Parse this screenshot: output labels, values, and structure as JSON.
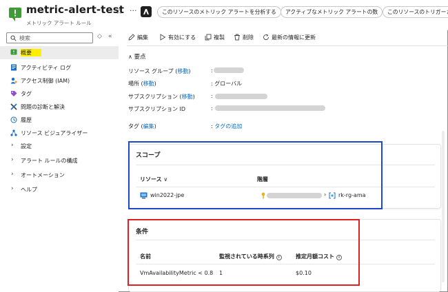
{
  "header": {
    "title": "metric-alert-test",
    "subtitle": "メトリック アラート ルール",
    "star": "☆",
    "more": "···",
    "pills": [
      "このリソースのメトリック アラートを分析する",
      "アクティブなメトリック アラートの数",
      "このリソースのトリガーさ"
    ]
  },
  "sidebar": {
    "search_placeholder": "検索",
    "items": [
      {
        "label": "概要",
        "icon": "overview-icon",
        "selected": true
      },
      {
        "label": "アクティビティ ログ",
        "icon": "activity-log-icon"
      },
      {
        "label": "アクセス制御 (IAM)",
        "icon": "iam-icon"
      },
      {
        "label": "タグ",
        "icon": "tag-icon"
      },
      {
        "label": "問題の診断と解決",
        "icon": "diagnose-icon"
      },
      {
        "label": "履歴",
        "icon": "history-icon"
      },
      {
        "label": "リソース ビジュアライザー",
        "icon": "visualizer-icon"
      },
      {
        "label": "設定",
        "icon": "chevron-right-icon"
      },
      {
        "label": "アラート ルールの構成",
        "icon": "chevron-right-icon"
      },
      {
        "label": "オートメーション",
        "icon": "chevron-right-icon"
      },
      {
        "label": "ヘルプ",
        "icon": "chevron-right-icon"
      }
    ]
  },
  "toolbar": {
    "edit": "編集",
    "enable": "有効にする",
    "duplicate": "複製",
    "delete": "削除",
    "refresh": "最新の情報に更新"
  },
  "essentials": {
    "heading": "要点",
    "resource_group_label": "リソース グループ",
    "move_link": "移動",
    "location_label": "場所",
    "location_value": ": グローバル",
    "subscription_label": "サブスクリプション",
    "subscription_id_label": "サブスクリプション ID",
    "tags_label": "タグ",
    "edit_link": "編集",
    "add_tag_link": "タグの追加",
    "colon": ":"
  },
  "scope": {
    "title": "スコープ",
    "col_resource": "リソース",
    "col_hierarchy": "階層",
    "resource": "win2022-jpe",
    "rg": "rk-rg-ama"
  },
  "condition": {
    "title": "条件",
    "col_name": "名前",
    "col_series": "監視されている時系列",
    "col_cost": "推定月額コスト",
    "name": "VmAvailabilityMetric < 0.8",
    "series": "1",
    "cost": "$0.10"
  },
  "colors": {
    "accent": "#0f6cbd",
    "annotation_blue": "#1e47c8",
    "annotation_red": "#e02020",
    "highlight": "#ffee00",
    "icon_green": "#3f9b35"
  }
}
